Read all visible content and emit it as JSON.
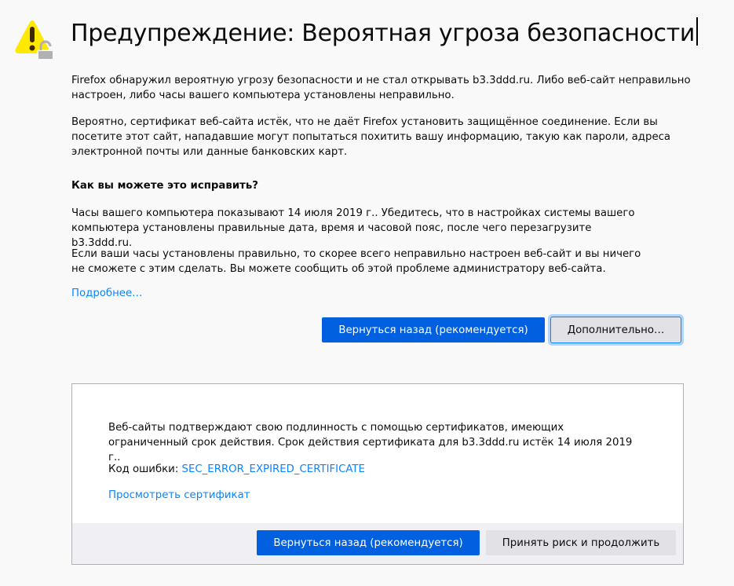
{
  "title": "Предупреждение: Вероятная угроза безопасности",
  "paragraphs": [
    "Firefox обнаружил вероятную угрозу безопасности и не стал открывать b3.3ddd.ru. Либо веб-сайт неправильно настроен, либо часы вашего компьютера установлены неправильно.",
    "Вероятно, сертификат веб-сайта истёк, что не даёт Firefox установить защищённое соединение. Если вы посетите этот сайт, нападавшие могут попытаться похитить вашу информацию, такую как пароли, адреса электронной почты или данные банковских карт."
  ],
  "fix_heading": "Как вы можете это исправить?",
  "fix_paragraphs": [
    "Часы вашего компьютера показывают 14 июля 2019 г.. Убедитесь, что в настройках системы вашего компьютера установлены правильные дата, время и часовой пояс, после чего перезагрузите b3.3ddd.ru.",
    "Если ваши часы установлены правильно, то скорее всего неправильно настроен веб-сайт и вы ничего не сможете с этим сделать. Вы можете сообщить об этой проблеме администратору веб-сайта."
  ],
  "learn_more": "Подробнее…",
  "go_back": "Вернуться назад (рекомендуется)",
  "advanced": "Дополнительно…",
  "advanced_panel": {
    "text": "Веб-сайты подтверждают свою подлинность с помощью сертификатов, имеющих ограниченный срок действия. Срок действия сертификата для b3.3ddd.ru истёк 14 июля 2019 г..",
    "error_label": "Код ошибки:",
    "error_code": "SEC_ERROR_EXPIRED_CERTIFICATE",
    "view_cert": "Просмотреть сертификат",
    "go_back": "Вернуться назад (рекомендуется)",
    "accept": "Принять риск и продолжить"
  }
}
